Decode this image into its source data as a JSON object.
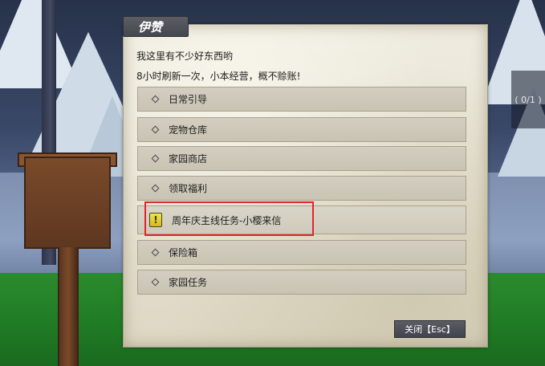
{
  "npc": {
    "name": "伊赞"
  },
  "greeting": {
    "line1": "我这里有不少好东西哟",
    "line2": "8小时刷新一次，小本经营，概不赊账!"
  },
  "menu": {
    "items": [
      {
        "label": "日常引导",
        "icon": "diamond-bullet"
      },
      {
        "label": "宠物仓库",
        "icon": "diamond-bullet"
      },
      {
        "label": "家园商店",
        "icon": "diamond-bullet"
      },
      {
        "label": "领取福利",
        "icon": "diamond-bullet"
      },
      {
        "label": "周年庆主线任务-小樱来信",
        "icon": "quest-exclamation",
        "highlighted": true
      },
      {
        "label": "保险箱",
        "icon": "diamond-bullet"
      },
      {
        "label": "家园任务",
        "icon": "diamond-bullet"
      }
    ]
  },
  "quest_icon_glyph": "!",
  "close_button": {
    "label": "关闭【Esc】"
  },
  "side_counter": {
    "text": "( 0/1 )"
  },
  "colors": {
    "highlight_border": "#e3262b",
    "panel_bg": "#e7e3d3",
    "menu_item_bg": "#cfcabb",
    "button_bg": "#45474e",
    "quest_icon": "#f3e24a"
  }
}
